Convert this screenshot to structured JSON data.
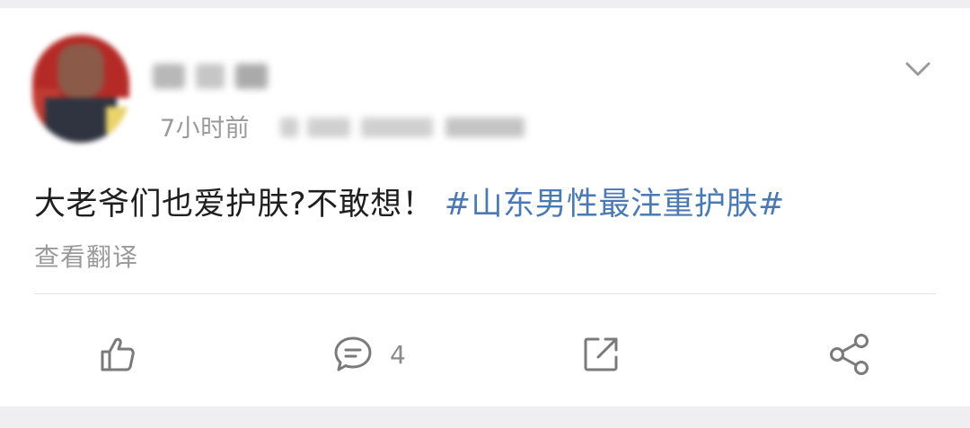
{
  "post": {
    "time": "7小时前",
    "text": "大老爷们也爱护肤?不敢想！",
    "hashtag": "#山东男性最注重护肤#",
    "translate_label": "查看翻译"
  },
  "actions": {
    "like": {
      "icon": "thumbs-up-icon"
    },
    "comment": {
      "icon": "comment-bubble-icon",
      "count": "4"
    },
    "repost": {
      "icon": "external-share-icon"
    },
    "share": {
      "icon": "share-nodes-icon"
    }
  },
  "colors": {
    "hashtag": "#4a79b3",
    "icon": "#7a7a7a",
    "background": "#efeff1"
  }
}
